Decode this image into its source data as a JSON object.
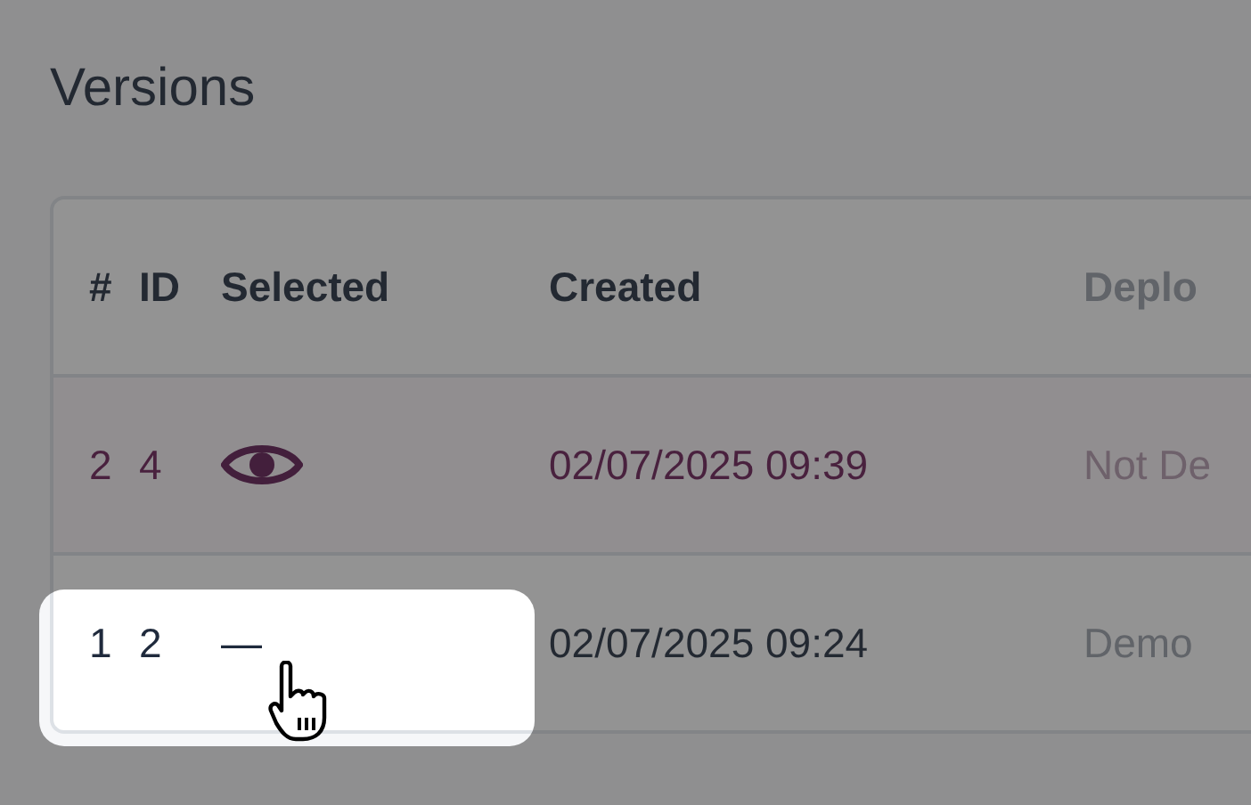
{
  "page": {
    "title": "Versions"
  },
  "table": {
    "columns": [
      "#",
      "ID",
      "Selected",
      "Created",
      "Deplo"
    ],
    "rows": [
      {
        "index": "2",
        "id": "4",
        "selected": true,
        "spotlight": false,
        "created": "02/07/2025 09:39",
        "deployment": "Not De"
      },
      {
        "index": "1",
        "id": "2",
        "selected": false,
        "selected_text": "—",
        "spotlight": true,
        "created": "02/07/2025 09:24",
        "deployment": "Demo"
      }
    ]
  }
}
